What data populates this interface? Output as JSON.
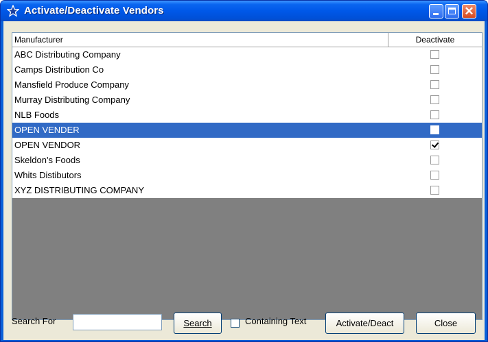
{
  "window": {
    "title": "Activate/Deactivate Vendors",
    "title_color": "#ffffff",
    "titlebar_color": "#0058e8"
  },
  "grid": {
    "columns": [
      "Manufacturer",
      "Deactivate"
    ],
    "rows": [
      {
        "name": "ABC Distributing Company",
        "deactivate": false,
        "selected": false
      },
      {
        "name": "Camps Distribution Co",
        "deactivate": false,
        "selected": false
      },
      {
        "name": "Mansfield Produce Company",
        "deactivate": false,
        "selected": false
      },
      {
        "name": "Murray Distributing Company",
        "deactivate": false,
        "selected": false
      },
      {
        "name": "NLB Foods",
        "deactivate": false,
        "selected": false
      },
      {
        "name": "OPEN VENDER",
        "deactivate": false,
        "selected": true
      },
      {
        "name": "OPEN VENDOR",
        "deactivate": true,
        "selected": false
      },
      {
        "name": "Skeldon's Foods",
        "deactivate": false,
        "selected": false
      },
      {
        "name": "Whits Distibutors",
        "deactivate": false,
        "selected": false
      },
      {
        "name": "XYZ DISTRIBUTING COMPANY",
        "deactivate": false,
        "selected": false
      }
    ],
    "selection_color": "#316ac5"
  },
  "bottom": {
    "search_label": "Search For",
    "search_value": "",
    "search_button": "Search",
    "containing_text_label": "Containing Text",
    "containing_text_checked": false,
    "activate_button": "Activate/Deact",
    "close_button": "Close"
  }
}
